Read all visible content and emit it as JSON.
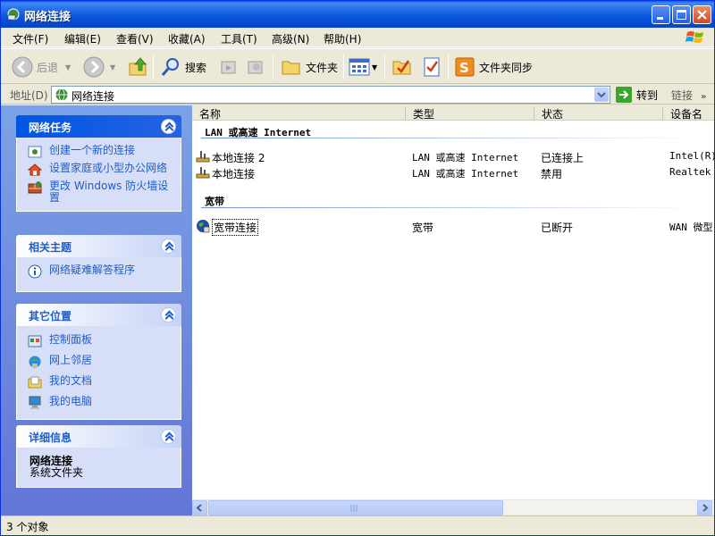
{
  "window": {
    "title": "网络连接"
  },
  "menu": [
    "文件(F)",
    "编辑(E)",
    "查看(V)",
    "收藏(A)",
    "工具(T)",
    "高级(N)",
    "帮助(H)"
  ],
  "toolbar": {
    "back": "后退",
    "search": "搜索",
    "folders": "文件夹",
    "sync": "文件夹同步"
  },
  "address": {
    "label": "地址(D)",
    "value": "网络连接",
    "go": "转到",
    "links": "链接"
  },
  "taskpane": {
    "network_tasks": {
      "title": "网络任务",
      "items": [
        "创建一个新的连接",
        "设置家庭或小型办公网络",
        "更改 Windows 防火墙设置"
      ]
    },
    "related": {
      "title": "相关主题",
      "items": [
        "网络疑难解答程序"
      ]
    },
    "other_places": {
      "title": "其它位置",
      "items": [
        "控制面板",
        "网上邻居",
        "我的文档",
        "我的电脑"
      ]
    },
    "details": {
      "title": "详细信息",
      "name": "网络连接",
      "type": "系统文件夹"
    }
  },
  "columns": [
    "名称",
    "类型",
    "状态",
    "设备名"
  ],
  "groups": [
    {
      "title": "LAN 或高速 Internet",
      "rows": [
        {
          "name": "本地连接 2",
          "type": "LAN 或高速 Internet",
          "status": "已连接上",
          "device": "Intel(R)"
        },
        {
          "name": "本地连接",
          "type": "LAN 或高速 Internet",
          "status": "禁用",
          "device": "Realtek"
        }
      ]
    },
    {
      "title": "宽带",
      "rows": [
        {
          "name": "宽带连接",
          "type": "宽带",
          "status": "已断开",
          "device": "WAN 微型"
        }
      ]
    }
  ],
  "status": {
    "text": "3 个对象"
  },
  "colors": {
    "title_blue": "#0855DD",
    "task_link": "#215DC6",
    "pane_bg": "#6B88DE"
  }
}
